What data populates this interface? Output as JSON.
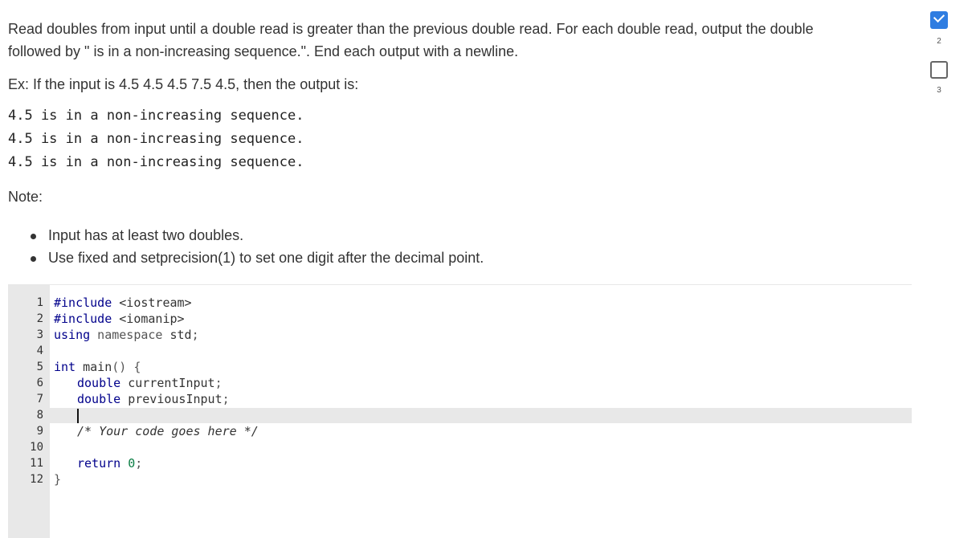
{
  "instructions": {
    "line1": "Read doubles from input until a double read is greater than the previous double read. For each double read, output the double",
    "line2": "followed by \" is in a non-increasing sequence.\". End each output with a newline.",
    "example": "Ex: If the input is 4.5 4.5 4.5 7.5 4.5, then the output is:",
    "output_lines": [
      "4.5 is in a non-increasing sequence.",
      "4.5 is in a non-increasing sequence.",
      "4.5 is in a non-increasing sequence."
    ],
    "note_label": "Note:",
    "notes": [
      "Input has at least two doubles.",
      "Use fixed and setprecision(1) to set one digit after the decimal point."
    ]
  },
  "editor": {
    "line_numbers": [
      "1",
      "2",
      "3",
      "4",
      "5",
      "6",
      "7",
      "8",
      "9",
      "10",
      "11",
      "12"
    ],
    "lines": {
      "l1_kw": "#include",
      "l1_rest": " <iostream>",
      "l2_kw": "#include",
      "l2_rest": " <iomanip>",
      "l3_kw": "using",
      "l3_ns": " namespace",
      "l3_rest": " std",
      "l3_semi": ";",
      "l5_type": "int",
      "l5_rest": " main",
      "l5_paren": "() {",
      "l6_type": "double",
      "l6_rest": " currentInput",
      "l6_semi": ";",
      "l7_type": "double",
      "l7_rest": " previousInput",
      "l7_semi": ";",
      "l9": "/* Your code goes here */",
      "l11_kw": "return",
      "l11_num": " 0",
      "l11_semi": ";",
      "l12": "}"
    }
  },
  "progress": {
    "steps": [
      {
        "number": "2",
        "status": "completed"
      },
      {
        "number": "3",
        "status": "incomplete"
      }
    ]
  },
  "colors": {
    "accent": "#2f7de1",
    "gutter": "#e8e8e8",
    "keyword": "#00008b",
    "number": "#0a7d44"
  }
}
